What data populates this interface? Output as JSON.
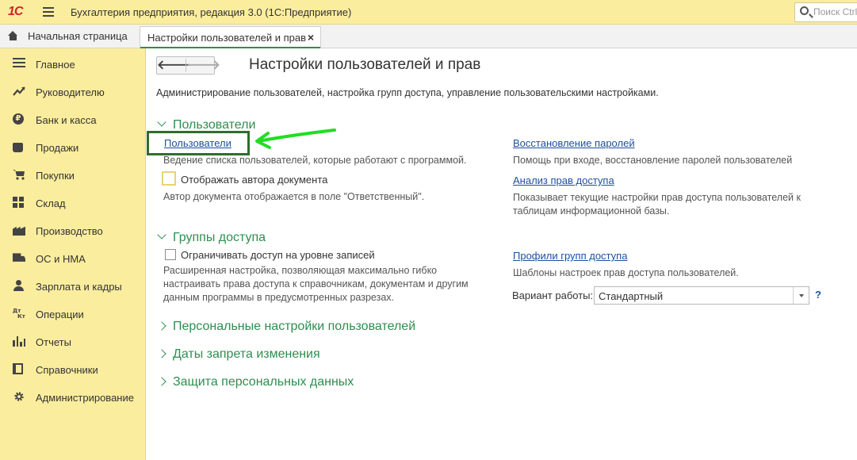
{
  "titlebar": {
    "logo": "1С",
    "title": "Бухгалтерия предприятия, редакция 3.0  (1С:Предприятие)",
    "search_placeholder": "Поиск Ctrl+Shift+F"
  },
  "tabs": {
    "home_label": "Начальная страница",
    "active_label": "Настройки пользователей и прав",
    "close_glyph": "×"
  },
  "sidebar": {
    "items": [
      {
        "label": "Главное",
        "icon": "menu-lines-icon"
      },
      {
        "label": "Руководителю",
        "icon": "trend-icon"
      },
      {
        "label": "Банк и касса",
        "icon": "ruble-coin-icon"
      },
      {
        "label": "Продажи",
        "icon": "bag-icon"
      },
      {
        "label": "Покупки",
        "icon": "cart-icon"
      },
      {
        "label": "Склад",
        "icon": "warehouse-icon"
      },
      {
        "label": "Производство",
        "icon": "factory-icon"
      },
      {
        "label": "ОС и НМА",
        "icon": "truck-icon"
      },
      {
        "label": "Зарплата и кадры",
        "icon": "person-icon"
      },
      {
        "label": "Операции",
        "icon": "dt-kt-icon"
      },
      {
        "label": "Отчеты",
        "icon": "bar-chart-icon"
      },
      {
        "label": "Справочники",
        "icon": "book-icon"
      },
      {
        "label": "Администрирование",
        "icon": "gear-icon"
      }
    ]
  },
  "main": {
    "back_glyph": "🡐",
    "forward_glyph": "🡒",
    "title": "Настройки пользователей и прав",
    "description": "Администрирование пользователей, настройка групп доступа, управление пользовательскими настройками.",
    "users_section": {
      "heading": "Пользователи",
      "users_link": "Пользователи",
      "users_hint": "Ведение списка пользователей, которые работают с программой.",
      "show_author_label": "Отображать автора документа",
      "show_author_hint": "Автор документа отображается в поле \"Ответственный\".",
      "password_link": "Восстановление паролей",
      "password_hint": "Помощь при входе, восстановление паролей пользователей",
      "rights_link": "Анализ прав доступа",
      "rights_hint": "Показывает текущие настройки прав доступа пользователей к таблицам информационной базы."
    },
    "groups_section": {
      "heading": "Группы доступа",
      "restrict_label": "Ограничивать доступ на уровне записей",
      "restrict_hint": "Расширенная настройка, позволяющая максимально гибко настраивать права доступа к справочникам, документам и другим данным программы в предусмотренных разрезах.",
      "profiles_link": "Профили групп доступа",
      "profiles_hint": "Шаблоны настроек прав доступа пользователей.",
      "variant_label": "Вариант работы:",
      "variant_value": "Стандартный",
      "help_glyph": "?"
    },
    "collapsed_sections": [
      "Персональные настройки пользователей",
      "Даты запрета изменения",
      "Защита персональных данных"
    ]
  },
  "colors": {
    "accent_green": "#2f8d4f",
    "sidebar_bg": "#fbed9e",
    "link_blue": "#1d4f9e",
    "annotation_arrow": "#22dd22"
  }
}
